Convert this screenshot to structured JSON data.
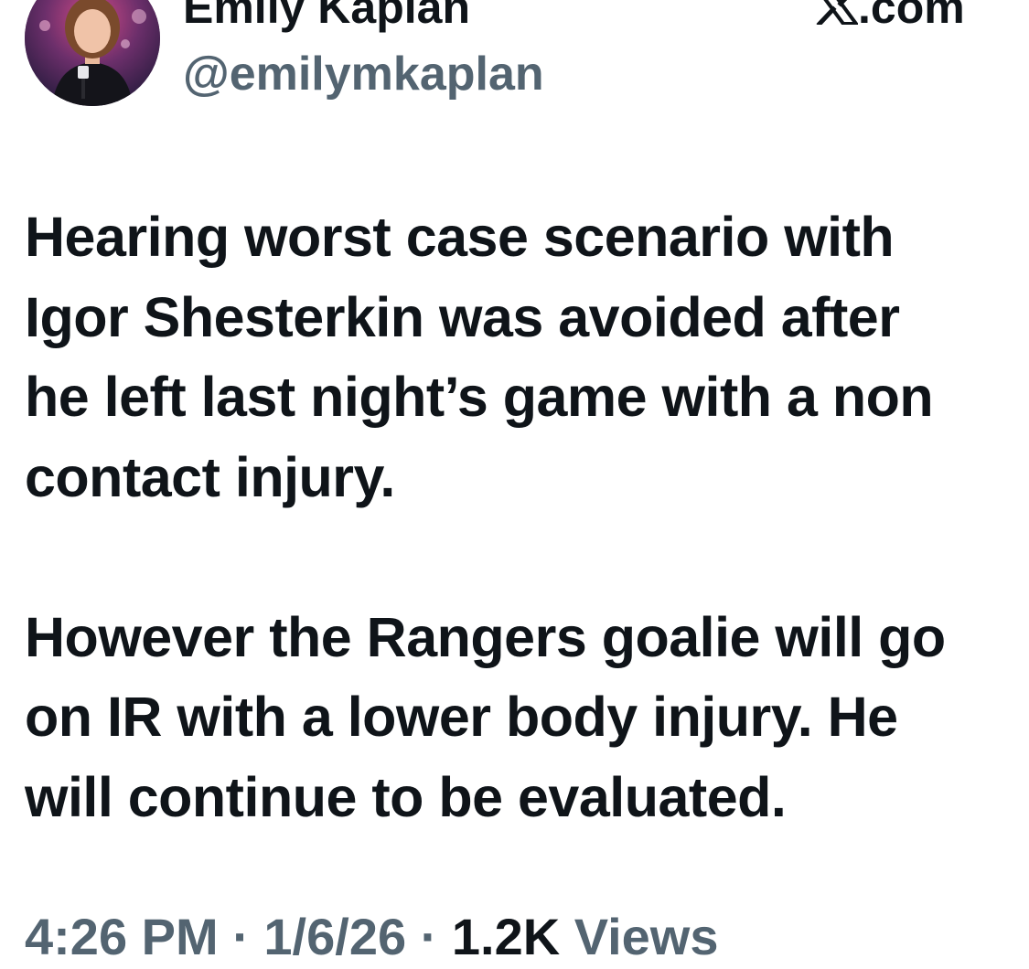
{
  "author": {
    "display_name": "Emily Kaplan",
    "handle": "@emilymkaplan",
    "avatar": "profile-photo"
  },
  "source": {
    "icon": "x-logo-icon",
    "suffix": ".com"
  },
  "tweet": {
    "paragraph_1": "Hearing worst case scenario with\nIgor Shesterkin was avoided after\nhe left last night’s game with a non\ncontact injury.",
    "paragraph_2": "However the Rangers goalie will go\non IR with a lower body injury. He\nwill continue to be evaluated."
  },
  "meta": {
    "time": "4:26 PM",
    "separator": " · ",
    "date": "1/6/26",
    "views_count": "1.2K",
    "views_label": "Views"
  },
  "colors": {
    "text_primary": "#0f1419",
    "text_secondary": "#536471",
    "background": "#ffffff"
  }
}
